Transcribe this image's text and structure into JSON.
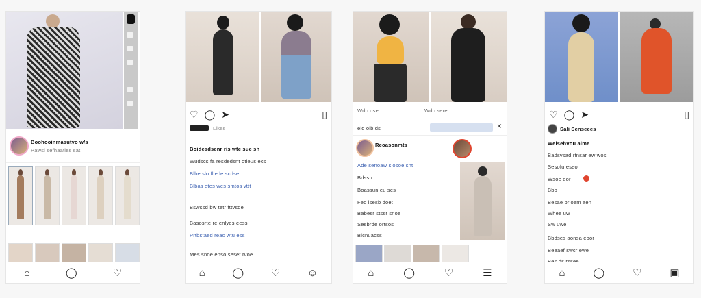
{
  "phone1": {
    "profile_name": "Boohooinmasutvo w/s",
    "profile_sub": "Pawsi sefhaatles sat",
    "icons": [
      "home-icon",
      "search-icon",
      "heart-icon"
    ]
  },
  "phone2": {
    "likes_text": "Likes",
    "caption_lines": [
      "Boidesdsenr ris wte sue sh",
      "Wudscs fa resdedsnt otieus ecs",
      "Blhe slo flle le scdse",
      "Blbas etes wes smtos vttt",
      "Bswssd bw tetr fttvsde",
      "Basosrte re enlyes eess",
      "Prtbstaed reac wtu ess",
      "Mes snoe enso seset rvoe"
    ],
    "icons": [
      "home-icon",
      "search-icon",
      "heart-icon",
      "profile-icon"
    ]
  },
  "phone3": {
    "header_left": "Wdo ose",
    "header_right": "Wdo sere",
    "search_label": "eld olb ds",
    "profile_name": "Reoasonmts",
    "lines": [
      "Ade senoaw siosoe snt",
      "Bdssu",
      "Boassun eu ses",
      "Feo isesb doet",
      "Babesr stssr snoe",
      "Sesbrde ortsos",
      "Blcnuacss"
    ],
    "icons": [
      "home-icon",
      "search-icon",
      "heart-icon",
      "menu-icon"
    ]
  },
  "phone4": {
    "profile_name": "Sali Senseees",
    "lines": [
      "Welsehvou alme",
      "Badsvsad rtnsar ew wos",
      "Sesofu eseo",
      "Wsoe eor",
      "Bbo",
      "Besae brloem aen",
      "Whee uw",
      "Sw uwe",
      "Bbdses aonsa eoor",
      "Beeaef swcr ewe",
      "Bes ds rssee"
    ],
    "icons": [
      "home-icon",
      "search-icon",
      "heart-icon",
      "bookmark-icon"
    ]
  },
  "colors": {
    "link": "#3a5fb0",
    "accent": "#e0452f",
    "avatar_ring": "#f0a8c8"
  }
}
